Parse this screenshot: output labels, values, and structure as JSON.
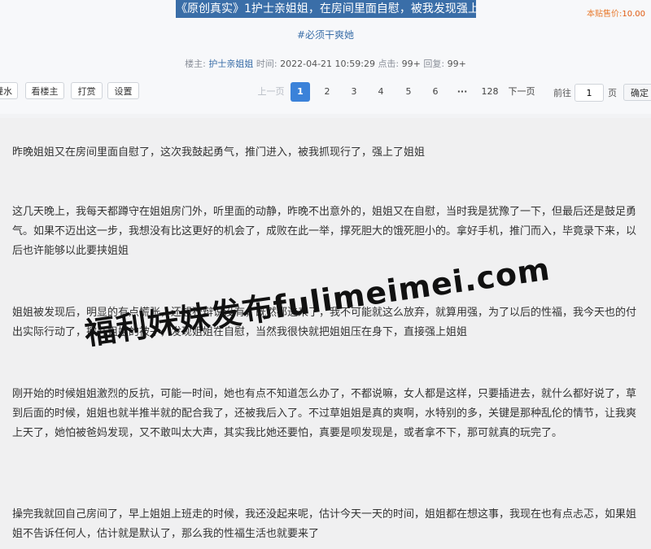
{
  "post": {
    "title": "《原创真实》1护士亲姐姐，在房间里面自慰，被我发现强上",
    "price_label": "本贴售价:",
    "price_value": "10.00",
    "tag": "#必须干爽她",
    "meta": {
      "poster_label": "楼主:",
      "poster": "护士亲姐姐",
      "time_label": "时间:",
      "time": "2022-04-21 10:59:29",
      "clicks_label": "点击:",
      "clicks": "99+",
      "replies_label": "回复:",
      "replies": "99+"
    }
  },
  "actions": {
    "water": "灌水",
    "only_op": "看楼主",
    "tip": "打赏",
    "settings": "设置"
  },
  "pagination": {
    "prev": "上一页",
    "pages": [
      "1",
      "2",
      "3",
      "4",
      "5",
      "6"
    ],
    "ellipsis": "···",
    "last": "128",
    "next": "下一页",
    "current": "1",
    "goto_label": "前往",
    "goto_value": "1",
    "page_unit": "页",
    "confirm": "确定"
  },
  "content": {
    "paragraphs": [
      "昨晚姐姐又在房间里面自慰了，这次我鼓起勇气，推门进入，被我抓现行了，强上了姐姐",
      "这几天晚上，我每天都蹲守在姐姐房门外，听里面的动静，昨晚不出意外的，姐姐又在自慰，当时我是犹豫了一下，但最后还是鼓足勇气。如果不迈出这一步，我想没有比这更好的机会了，成败在此一举，撑死胆大的饿死胆小的。拿好手机，推门而入，毕竟录下来，以后也许能够以此要挟姐姐",
      "姐姐被发现后，明显的有点慌张，还想狡辩说没有，既然都进来了，我不可能就这么放弃，就算用强，为了以后的性福，我今天也的付出实际行动了，掀开姐姐的被子，发现姐姐在自慰，当然我很快就把姐姐压在身下，直接强上姐姐",
      "刚开始的时候姐姐激烈的反抗，可能一时间，她也有点不知道怎么办了，不都说嘛，女人都是这样，只要插进去，就什么都好说了，草到后面的时候，姐姐也就半推半就的配合我了，还被我后入了。不过草姐姐是真的爽啊，水特别的多，关键是那种乱伦的情节，让我爽上天了，她怕被爸妈发现，又不敢叫太大声，其实我比她还要怕，真要是呗发现是，或者拿不下，那可就真的玩完了。",
      "操完我就回自己房间了，早上姐姐上班走的时候，我还没起来呢，估计今天一天的时间，姐姐都在想这事，我现在也有点忐忑，如果姐姐不告诉任何人，估计就是默认了，那么我的性福生活也就要来了"
    ],
    "watermark": "福利妹妹发布fulimeimei.com"
  }
}
